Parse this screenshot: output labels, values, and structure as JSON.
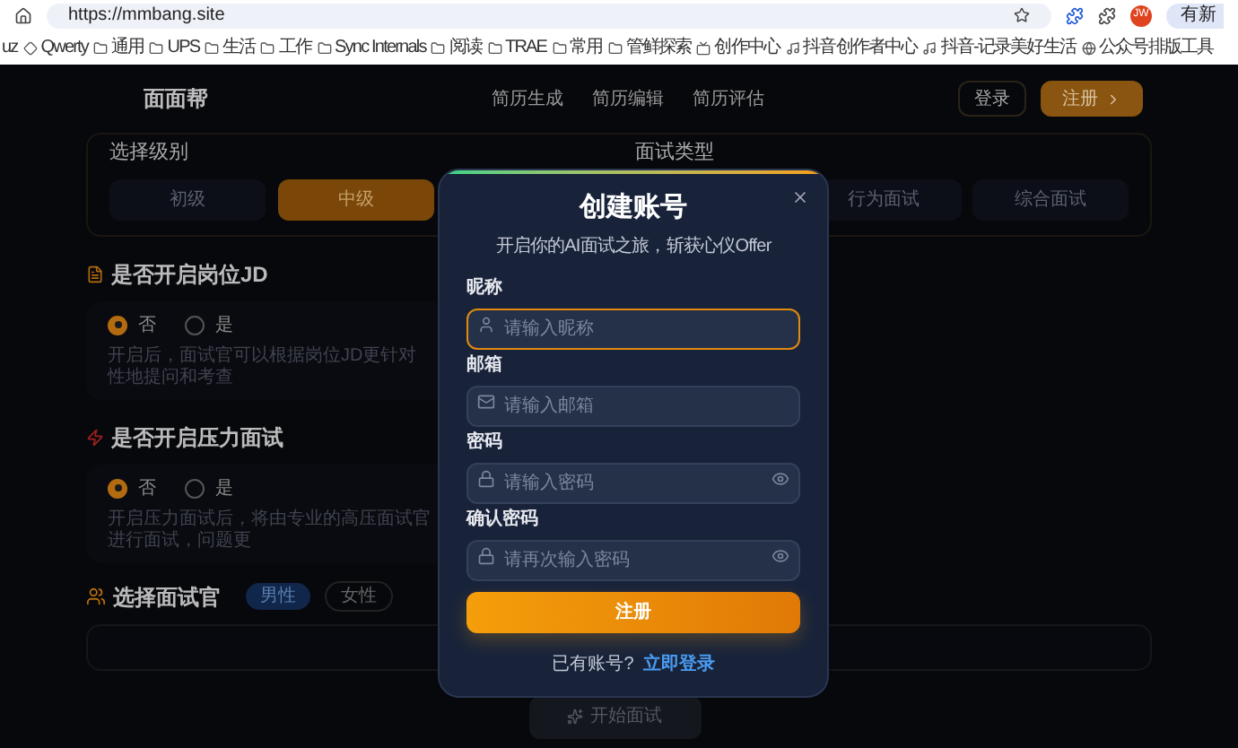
{
  "browser": {
    "url": "https://mmbang.site",
    "profile_initials": "JW",
    "update_button": "有新",
    "bookmarks": [
      {
        "label": "uz",
        "kind": "text"
      },
      {
        "label": "Qwerty",
        "kind": "site"
      },
      {
        "label": "通用",
        "kind": "folder"
      },
      {
        "label": "UPS",
        "kind": "folder"
      },
      {
        "label": "生活",
        "kind": "folder"
      },
      {
        "label": "工作",
        "kind": "folder"
      },
      {
        "label": "Sync Internals",
        "kind": "folder"
      },
      {
        "label": "阅读",
        "kind": "folder"
      },
      {
        "label": "TRAE",
        "kind": "folder"
      },
      {
        "label": "常用",
        "kind": "folder"
      },
      {
        "label": "管鲜探索",
        "kind": "folder"
      },
      {
        "label": "创作中心",
        "kind": "tv"
      },
      {
        "label": "抖音创作者中心",
        "kind": "music"
      },
      {
        "label": "抖音-记录美好生活",
        "kind": "music"
      },
      {
        "label": "公众号排版工具",
        "kind": "globe"
      }
    ]
  },
  "nav": {
    "logo": "面面帮",
    "links": [
      "简历生成",
      "简历编辑",
      "简历评估"
    ],
    "login": "登录",
    "register": "注册"
  },
  "level_section": {
    "title": "选择级别",
    "options": [
      {
        "label": "初级",
        "selected": false
      },
      {
        "label": "中级",
        "selected": true
      }
    ]
  },
  "type_section": {
    "title": "面试类型",
    "options": [
      {
        "label": "行为面试",
        "selected": false
      },
      {
        "label": "综合面试",
        "selected": false
      }
    ]
  },
  "jd_section": {
    "title": "是否开启岗位JD",
    "options": [
      {
        "label": "否",
        "selected": true
      },
      {
        "label": "是",
        "selected": false
      }
    ],
    "description": "开启后，面试官可以根据岗位JD更针对性地提问和考查"
  },
  "pressure_section": {
    "title": "是否开启压力面试",
    "options": [
      {
        "label": "否",
        "selected": true
      },
      {
        "label": "是",
        "selected": false
      }
    ],
    "description": "开启压力面试后，将由专业的高压面试官进行面试，问题更"
  },
  "interviewer_section": {
    "title": "选择面试官",
    "tags": [
      {
        "label": "男性",
        "selected": true
      },
      {
        "label": "女性",
        "selected": false
      }
    ]
  },
  "start_button": "开始面试",
  "modal": {
    "title": "创建账号",
    "subtitle": "开启你的AI面试之旅，斩获心仪Offer",
    "fields": [
      {
        "label": "昵称",
        "placeholder": "请输入昵称",
        "kind": "user",
        "focused": true,
        "reveal": false
      },
      {
        "label": "邮箱",
        "placeholder": "请输入邮箱",
        "kind": "mail",
        "focused": false,
        "reveal": false
      },
      {
        "label": "密码",
        "placeholder": "请输入密码",
        "kind": "lock",
        "focused": false,
        "reveal": true
      },
      {
        "label": "确认密码",
        "placeholder": "请再次输入密码",
        "kind": "lock",
        "focused": false,
        "reveal": true
      }
    ],
    "submit": "注册",
    "footer_text": "已有账号?",
    "footer_link": "立即登录"
  }
}
